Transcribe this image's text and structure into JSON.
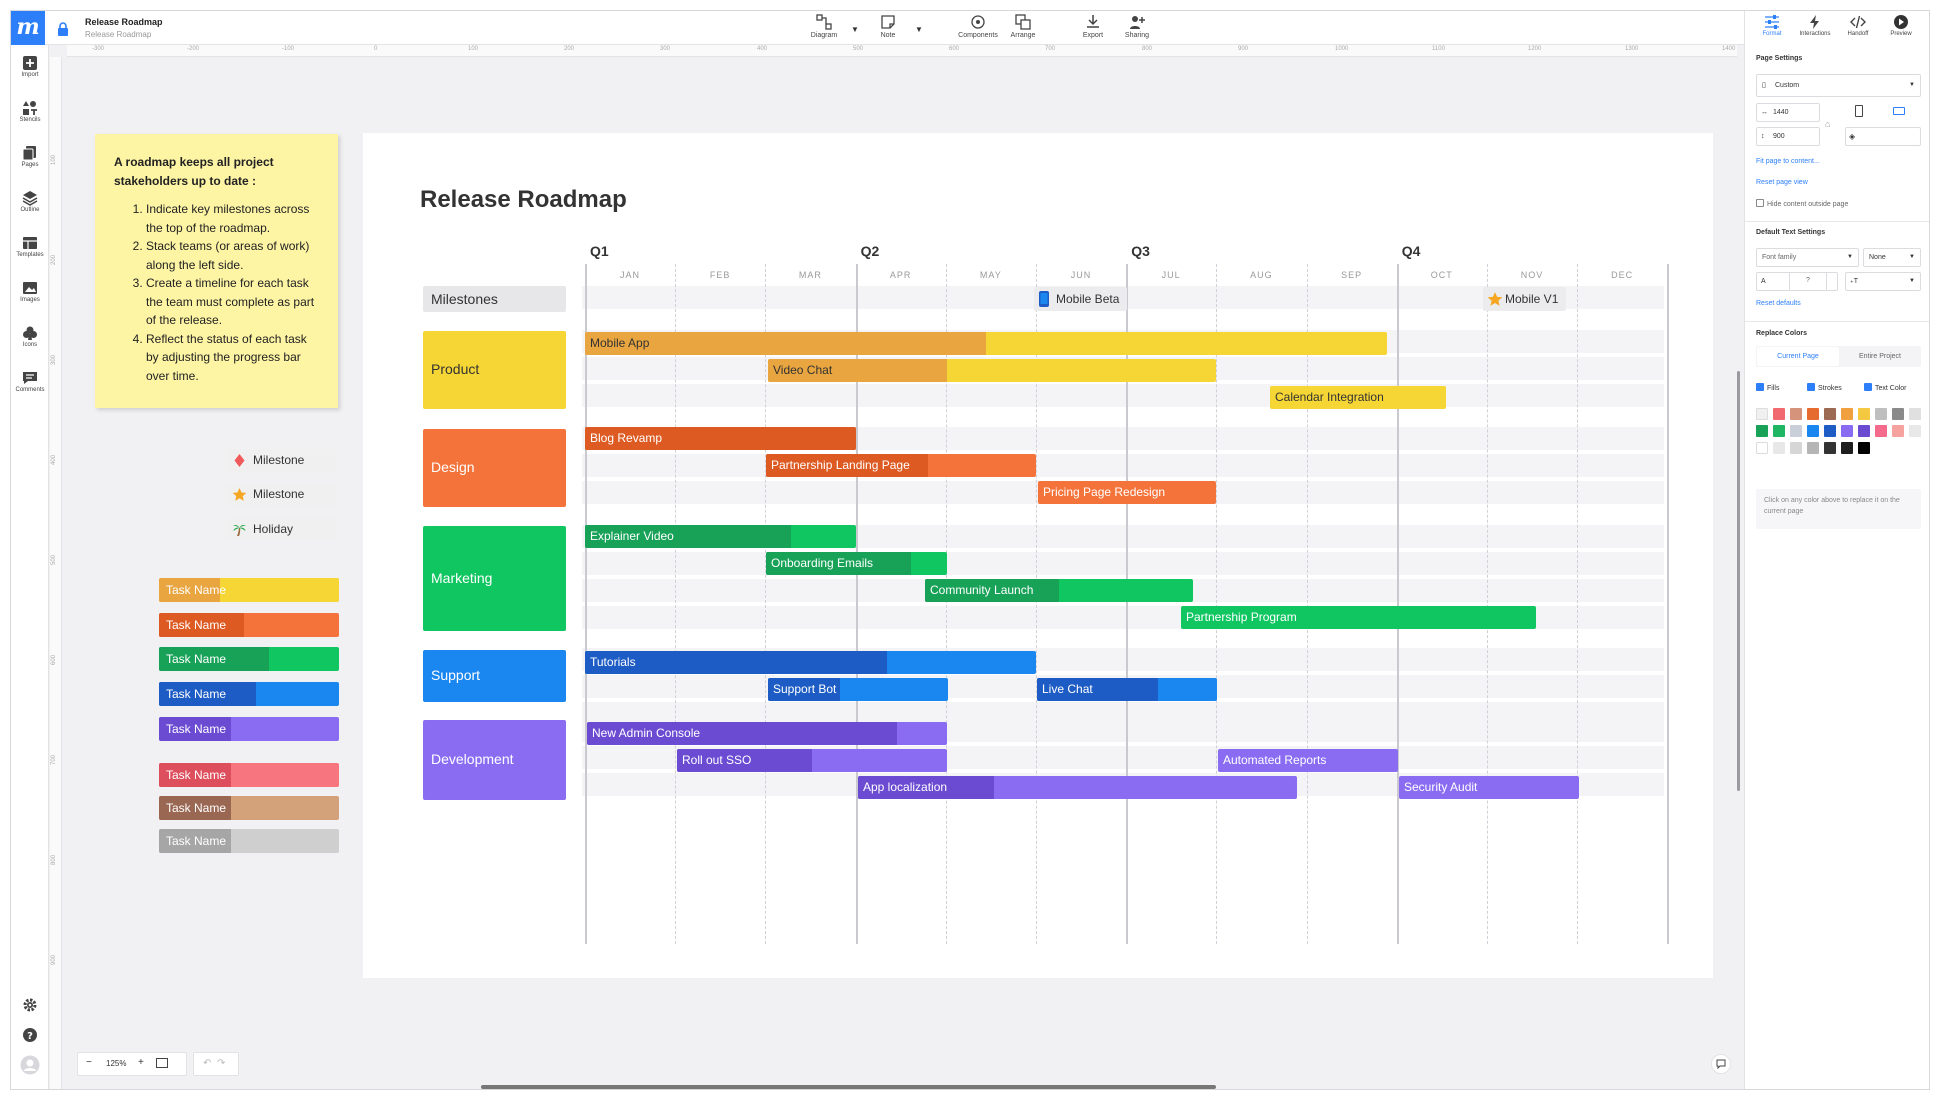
{
  "topbar": {
    "logo": "m",
    "title": "Release Roadmap",
    "subtitle": "Release Roadmap",
    "tools": [
      {
        "label": "Diagram",
        "icon": "diagram-icon"
      },
      {
        "label": "Note",
        "icon": "note-icon"
      },
      {
        "label": "Components",
        "icon": "components-icon"
      },
      {
        "label": "Arrange",
        "icon": "arrange-icon"
      },
      {
        "label": "Export",
        "icon": "export-icon"
      },
      {
        "label": "Sharing",
        "icon": "sharing-icon"
      }
    ]
  },
  "leftbar": {
    "items": [
      {
        "label": "Import",
        "icon": "plus-icon"
      },
      {
        "label": "Stencils",
        "icon": "stencils-icon"
      },
      {
        "label": "Pages",
        "icon": "pages-icon"
      },
      {
        "label": "Outline",
        "icon": "layers-icon"
      },
      {
        "label": "Templates",
        "icon": "templates-icon"
      },
      {
        "label": "Images",
        "icon": "image-icon"
      },
      {
        "label": "Icons",
        "icon": "club-icon"
      },
      {
        "label": "Comments",
        "icon": "comment-icon"
      }
    ]
  },
  "ruler": {
    "h": [
      "-300",
      "-200",
      "-100",
      "0",
      "100",
      "200",
      "300",
      "400",
      "500",
      "600",
      "700",
      "800",
      "900",
      "1000",
      "1100",
      "1200",
      "1300",
      "1400"
    ],
    "v": [
      "100",
      "200",
      "300",
      "400",
      "500",
      "600",
      "700",
      "800",
      "900"
    ]
  },
  "note": {
    "heading": "A roadmap keeps all project stakeholders up to date :",
    "items": [
      "Indicate key milestones across the top of the roadmap.",
      "Stack teams (or areas of work) along the left side.",
      "Create a timeline for each task the team must complete as part of the release.",
      "Reflect the status of each task by adjusting the progress bar over time."
    ]
  },
  "legend": {
    "symbols": [
      {
        "label": "Milestone",
        "icon": "diamond-icon"
      },
      {
        "label": "Milestone",
        "icon": "star-icon"
      },
      {
        "label": "Holiday",
        "icon": "palm-tree-icon"
      }
    ],
    "task_samples": [
      {
        "label": "Task Name",
        "dark": "#e9a53f",
        "light": "#f5d634",
        "progress": 0.34
      },
      {
        "label": "Task Name",
        "dark": "#dd5a22",
        "light": "#f4733a",
        "progress": 0.47
      },
      {
        "label": "Task Name",
        "dark": "#18a258",
        "light": "#10c661",
        "progress": 0.61
      },
      {
        "label": "Task Name",
        "dark": "#1e5cc5",
        "light": "#1a86f0",
        "progress": 0.54
      },
      {
        "label": "Task Name",
        "dark": "#6a4bd2",
        "light": "#8a6cf2",
        "progress": 0.4
      },
      {
        "label": "Task Name",
        "dark": "#de4f5d",
        "light": "#f6757e",
        "progress": 0.4
      },
      {
        "label": "Task Name",
        "dark": "#9a6852",
        "light": "#d3a27b",
        "progress": 0.4
      },
      {
        "label": "Task Name",
        "dark": "#a6a6a6",
        "light": "#cfcfcf",
        "progress": 0.4
      }
    ]
  },
  "roadmap": {
    "title": "Release Roadmap",
    "quarters": [
      "Q1",
      "Q2",
      "Q3",
      "Q4"
    ],
    "months": [
      "JAN",
      "FEB",
      "MAR",
      "APR",
      "MAY",
      "JUN",
      "JUL",
      "AUG",
      "SEP",
      "OCT",
      "NOV",
      "DEC"
    ],
    "milestones_label": "Milestones",
    "milestones": [
      {
        "label": "Mobile Beta",
        "icon": "phone-icon"
      },
      {
        "label": "Mobile V1",
        "icon": "star-icon"
      }
    ],
    "groups": [
      {
        "name": "Product",
        "color": "#f5d634",
        "tasks": [
          {
            "label": "Mobile App",
            "dark": "#e9a53f",
            "light": "#f5d634",
            "progress": 0.5,
            "text_dark": true
          },
          {
            "label": "Video Chat",
            "dark": "#e9a53f",
            "light": "#f5d634",
            "progress": 0.4,
            "text_dark": true
          },
          {
            "label": "Calendar Integration",
            "dark": "#e9a53f",
            "light": "#f5d634",
            "progress": 0.0,
            "text_dark": true
          }
        ]
      },
      {
        "name": "Design",
        "color": "#f4733a",
        "tasks": [
          {
            "label": "Blog Revamp",
            "dark": "#dd5a22",
            "light": "#f4733a",
            "progress": 1.0
          },
          {
            "label": "Partnership Landing Page",
            "dark": "#dd5a22",
            "light": "#f4733a",
            "progress": 0.6
          },
          {
            "label": "Pricing Page Redesign",
            "dark": "#dd5a22",
            "light": "#f4733a",
            "progress": 0.0
          }
        ]
      },
      {
        "name": "Marketing",
        "color": "#10c661",
        "tasks": [
          {
            "label": "Explainer Video",
            "dark": "#18a258",
            "light": "#10c661",
            "progress": 0.76
          },
          {
            "label": "Onboarding Emails",
            "dark": "#18a258",
            "light": "#10c661",
            "progress": 0.8
          },
          {
            "label": "Community Launch",
            "dark": "#18a258",
            "light": "#10c661",
            "progress": 0.5
          },
          {
            "label": "Partnership Program",
            "dark": "#18a258",
            "light": "#10c661",
            "progress": 0.0
          }
        ]
      },
      {
        "name": "Support",
        "color": "#1a86f0",
        "tasks": [
          {
            "label": "Tutorials",
            "dark": "#1e5cc5",
            "light": "#1a86f0",
            "progress": 0.67
          },
          {
            "label": "Support Bot",
            "dark": "#1e5cc5",
            "light": "#1a86f0",
            "progress": 0.4
          },
          {
            "label": "Live Chat",
            "dark": "#1e5cc5",
            "light": "#1a86f0",
            "progress": 0.67
          }
        ]
      },
      {
        "name": "Development",
        "color": "#8a6cf2",
        "tasks": [
          {
            "label": "New Admin Console",
            "dark": "#6a4bd2",
            "light": "#8a6cf2",
            "progress": 0.86
          },
          {
            "label": "Roll out SSO",
            "dark": "#6a4bd2",
            "light": "#8a6cf2",
            "progress": 0.5
          },
          {
            "label": "Automated Reports",
            "dark": "#6a4bd2",
            "light": "#8a6cf2",
            "progress": 0.0
          },
          {
            "label": "App localization",
            "dark": "#6a4bd2",
            "light": "#8a6cf2",
            "progress": 0.31
          },
          {
            "label": "Security Audit",
            "dark": "#6a4bd2",
            "light": "#8a6cf2",
            "progress": 0.0
          }
        ]
      }
    ]
  },
  "rightbar": {
    "tabs": [
      {
        "label": "Format",
        "icon": "sliders-icon",
        "active": true
      },
      {
        "label": "Interactions",
        "icon": "lightning-icon"
      },
      {
        "label": "Handoff",
        "icon": "code-icon"
      },
      {
        "label": "Preview",
        "icon": "play-icon"
      }
    ],
    "page_settings": "Page Settings",
    "preset": "Custom",
    "width": "1440",
    "height": "900",
    "fit_page": "Fit page to content...",
    "reset_view": "Reset page view",
    "hide_outside": "Hide content outside page",
    "text_settings": "Default Text Settings",
    "font_family": "Font family",
    "font_weight": "None",
    "font_size_placeholder": "?",
    "reset_defaults": "Reset defaults",
    "replace_colors": "Replace Colors",
    "tab_current": "Current Page",
    "tab_project": "Entire Project",
    "check_fills": "Fills",
    "check_strokes": "Strokes",
    "check_text": "Text Color",
    "swatches": [
      "#f0f0f0",
      "#f16a6f",
      "#d4937a",
      "#e56b2f",
      "#9c6a52",
      "#f0a03e",
      "#f5c842",
      "#bfbfbf",
      "#8a8a8a",
      "#e0e0e0",
      "#18a258",
      "#1eb563",
      "#c9ced8",
      "#1a86f0",
      "#1e5cc5",
      "#8a6cf2",
      "#6a4bd2",
      "#f36a8a",
      "#f6a3a0",
      "#e8e8e8",
      "#ffffff",
      "#e8e8e8",
      "#d6d6d6",
      "#b5b5b5",
      "#333333",
      "#1e1e1e",
      "#000000"
    ],
    "hint": "Click on any color above to replace it on the current page"
  },
  "bottom": {
    "zoom": "125%"
  }
}
